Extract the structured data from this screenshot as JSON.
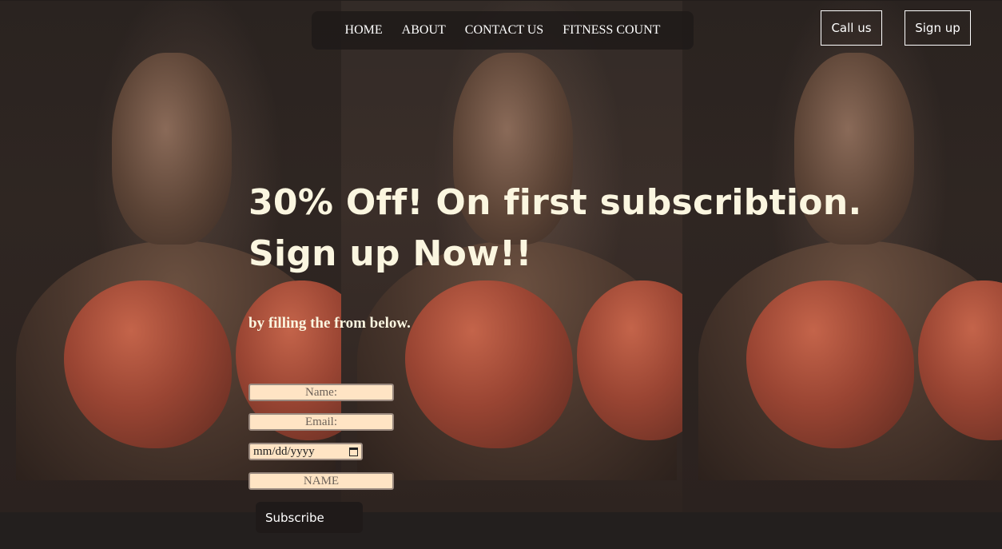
{
  "nav": {
    "items": [
      "HOME",
      "ABOUT",
      "CONTACT US",
      "FITNESS COUNT"
    ]
  },
  "header_buttons": {
    "call_label": "Call us",
    "signup_label": "Sign up"
  },
  "hero": {
    "title_line1": "30% Off! On first subscribtion.",
    "title_line2": "Sign up Now!!",
    "subtitle": "by filling the from below."
  },
  "form": {
    "name_placeholder": "Name:",
    "email_placeholder": "Email:",
    "date_value": "mm/dd/yyyy",
    "name2_placeholder": "NAME",
    "subscribe_label": "Subscribe"
  },
  "colors": {
    "input_bg": "#ffe4c4",
    "hero_text": "#fbf6e0",
    "glove": "#9a4533"
  }
}
